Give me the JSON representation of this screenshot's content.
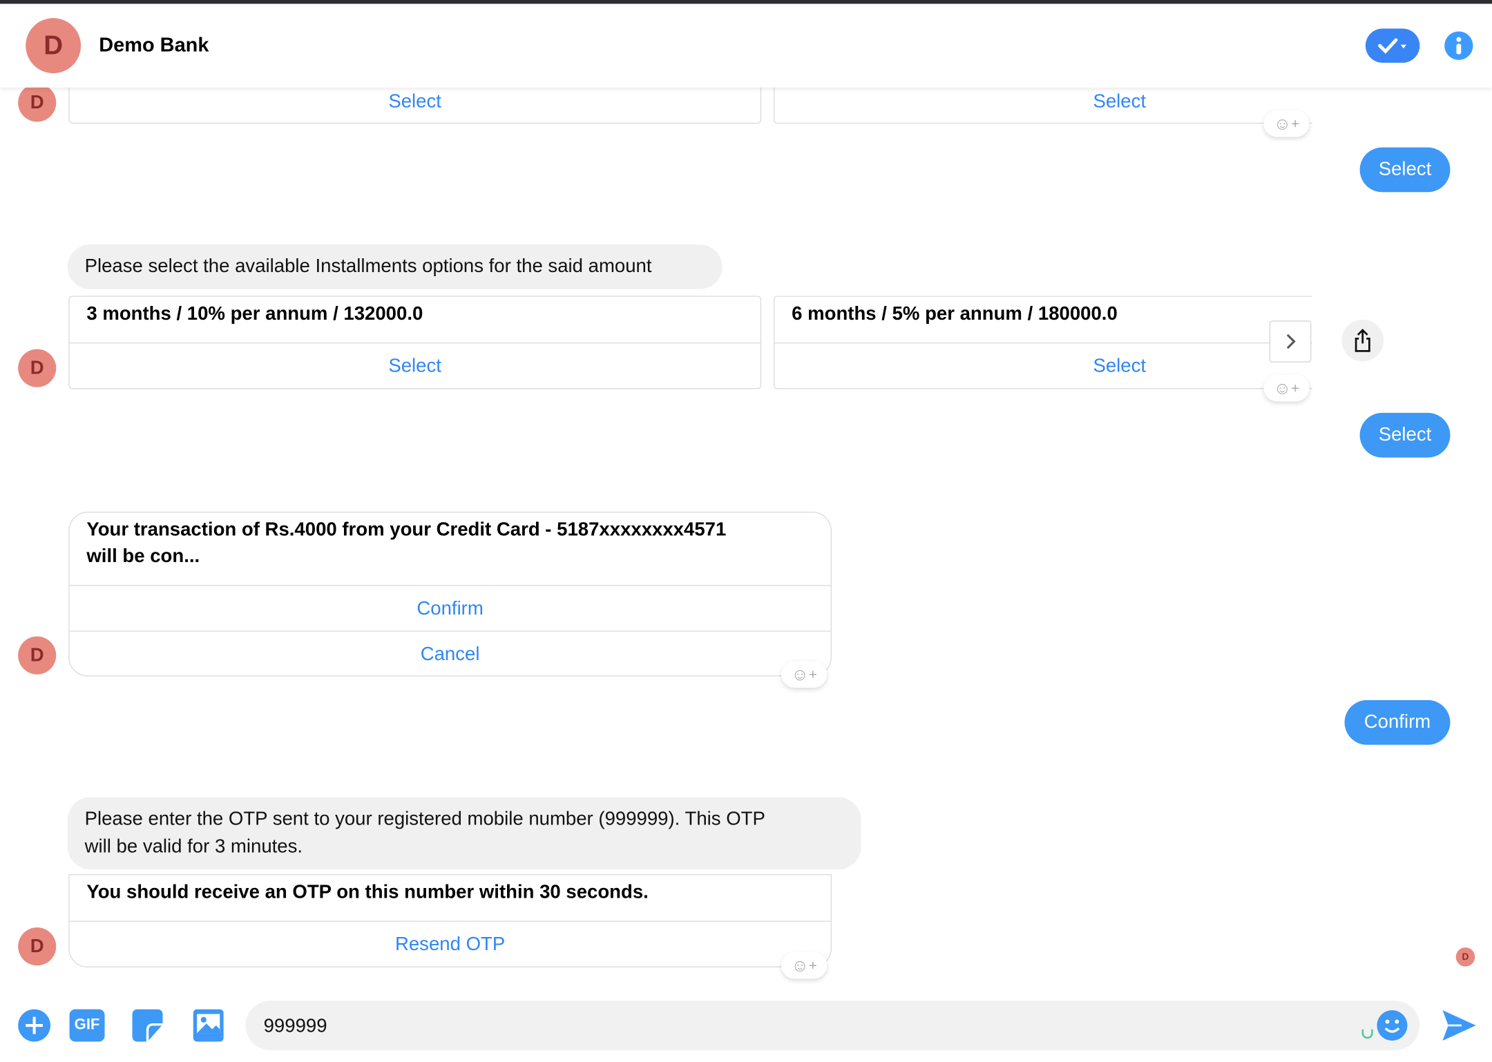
{
  "header": {
    "avatar_letter": "D",
    "title": "Demo Bank",
    "check_icon": "check-dropdown-icon",
    "info_icon": "info-icon"
  },
  "colors": {
    "accent": "#3a85f5",
    "avatar": "#e8897f",
    "bubble": "#f0f0f0",
    "link": "#2f86f6"
  },
  "messages": {
    "row1": {
      "avatar": "D",
      "cards": [
        {
          "button": "Select"
        },
        {
          "button": "Select"
        }
      ]
    },
    "reply1": "Select",
    "installments_prompt": "Please select the available Installments options for the said amount",
    "row2": {
      "avatar": "D",
      "cards": [
        {
          "title": "3 months / 10% per annum / 132000.0",
          "button": "Select"
        },
        {
          "title": "6 months / 5% per annum / 180000.0",
          "button": "Select"
        }
      ]
    },
    "reply2": "Select",
    "confirm_card": {
      "avatar": "D",
      "title_line1": "Your transaction of Rs.4000 from your Credit Card - 5187xxxxxxxx4571",
      "title_line2": "will be con...",
      "confirm": "Confirm",
      "cancel": "Cancel"
    },
    "reply3": "Confirm",
    "otp_prompt_line1": "Please enter the OTP sent to your registered mobile number (999999). This OTP",
    "otp_prompt_line2": "will be valid for 3 minutes.",
    "otp_card": {
      "avatar": "D",
      "title": "You should receive an OTP on this number within 30 seconds.",
      "button": "Resend OTP"
    },
    "seen_avatar": "D"
  },
  "composer": {
    "value": "999999",
    "gif_label": "GIF"
  }
}
